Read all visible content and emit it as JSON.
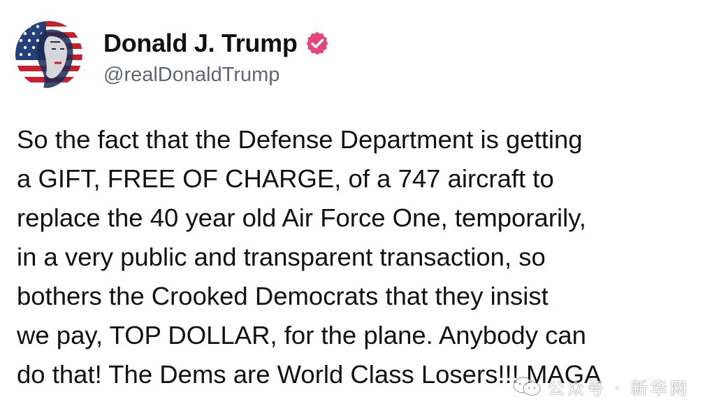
{
  "author": {
    "display_name": "Donald J. Trump",
    "handle": "@realDonaldTrump",
    "avatar": "flag-portrait-avatar",
    "verified_icon": "verified-badge-icon",
    "verified_color": "#e6477a"
  },
  "post": {
    "lines": [
      "So the fact that the Defense Department is getting",
      "a GIFT, FREE OF CHARGE, of a 747 aircraft to",
      "replace the 40 year old Air Force One, temporarily,",
      "in a very public and transparent transaction, so",
      "bothers the Crooked Democrats that they insist",
      "we pay, TOP DOLLAR, for the plane. Anybody can",
      "do that! The Dems are World Class Losers!!! MAGA"
    ]
  },
  "watermark": {
    "text": "公众号 · 新华网",
    "icon": "wechat-official-account-icon"
  },
  "colors": {
    "text": "#111111",
    "handle": "#606770",
    "background": "#ffffff"
  }
}
